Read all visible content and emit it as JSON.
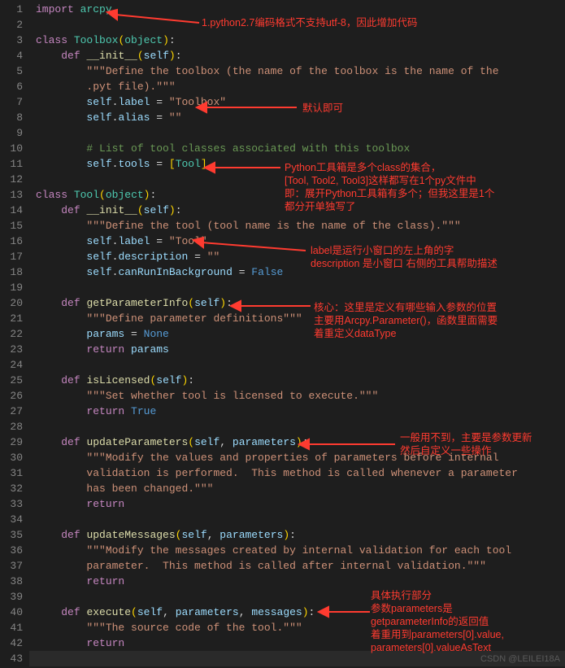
{
  "line_count": 43,
  "code_lines": {
    "l1": {
      "t": [
        [
          "kw",
          "import"
        ],
        [
          "op",
          " "
        ],
        [
          "cls",
          "arcpy"
        ]
      ]
    },
    "l2": {
      "t": []
    },
    "l3": {
      "t": [
        [
          "kw",
          "class"
        ],
        [
          "op",
          " "
        ],
        [
          "cls",
          "Toolbox"
        ],
        [
          "bracket1",
          "("
        ],
        [
          "cls",
          "object"
        ],
        [
          "bracket1",
          ")"
        ],
        [
          "op",
          ":"
        ]
      ]
    },
    "l4": {
      "indent": 1,
      "t": [
        [
          "kw",
          "def"
        ],
        [
          "op",
          " "
        ],
        [
          "fn",
          "__init__"
        ],
        [
          "bracket1",
          "("
        ],
        [
          "selfc",
          "self"
        ],
        [
          "bracket1",
          ")"
        ],
        [
          "op",
          ":"
        ]
      ]
    },
    "l5": {
      "indent": 2,
      "t": [
        [
          "str",
          "\"\"\"Define the toolbox (the name of the toolbox is the name of the"
        ]
      ]
    },
    "l6": {
      "indent": 2,
      "t": [
        [
          "str",
          ".pyt file).\"\"\""
        ]
      ]
    },
    "l7": {
      "indent": 2,
      "t": [
        [
          "selfc",
          "self"
        ],
        [
          "op",
          "."
        ],
        [
          "var",
          "label"
        ],
        [
          "op",
          " = "
        ],
        [
          "str",
          "\"Toolbox\""
        ]
      ]
    },
    "l8": {
      "indent": 2,
      "t": [
        [
          "selfc",
          "self"
        ],
        [
          "op",
          "."
        ],
        [
          "var",
          "alias"
        ],
        [
          "op",
          " = "
        ],
        [
          "str",
          "\"\""
        ]
      ]
    },
    "l9": {
      "t": []
    },
    "l10": {
      "indent": 2,
      "t": [
        [
          "cmt",
          "# List of tool classes associated with this toolbox"
        ]
      ]
    },
    "l11": {
      "indent": 2,
      "t": [
        [
          "selfc",
          "self"
        ],
        [
          "op",
          "."
        ],
        [
          "var",
          "tools"
        ],
        [
          "op",
          " = "
        ],
        [
          "bracket1",
          "["
        ],
        [
          "cls",
          "Tool"
        ],
        [
          "bracket1",
          "]"
        ]
      ]
    },
    "l12": {
      "t": []
    },
    "l13": {
      "t": [
        [
          "kw",
          "class"
        ],
        [
          "op",
          " "
        ],
        [
          "cls",
          "Tool"
        ],
        [
          "bracket1",
          "("
        ],
        [
          "cls",
          "object"
        ],
        [
          "bracket1",
          ")"
        ],
        [
          "op",
          ":"
        ]
      ]
    },
    "l14": {
      "indent": 1,
      "t": [
        [
          "kw",
          "def"
        ],
        [
          "op",
          " "
        ],
        [
          "fn",
          "__init__"
        ],
        [
          "bracket1",
          "("
        ],
        [
          "selfc",
          "self"
        ],
        [
          "bracket1",
          ")"
        ],
        [
          "op",
          ":"
        ]
      ]
    },
    "l15": {
      "indent": 2,
      "t": [
        [
          "str",
          "\"\"\"Define the tool (tool name is the name of the class).\"\"\""
        ]
      ]
    },
    "l16": {
      "indent": 2,
      "t": [
        [
          "selfc",
          "self"
        ],
        [
          "op",
          "."
        ],
        [
          "var",
          "label"
        ],
        [
          "op",
          " = "
        ],
        [
          "str",
          "\"Tool\""
        ]
      ]
    },
    "l17": {
      "indent": 2,
      "t": [
        [
          "selfc",
          "self"
        ],
        [
          "op",
          "."
        ],
        [
          "var",
          "description"
        ],
        [
          "op",
          " = "
        ],
        [
          "str",
          "\"\""
        ]
      ]
    },
    "l18": {
      "indent": 2,
      "t": [
        [
          "selfc",
          "self"
        ],
        [
          "op",
          "."
        ],
        [
          "var",
          "canRunInBackground"
        ],
        [
          "op",
          " = "
        ],
        [
          "const",
          "False"
        ]
      ]
    },
    "l19": {
      "t": []
    },
    "l20": {
      "indent": 1,
      "t": [
        [
          "kw",
          "def"
        ],
        [
          "op",
          " "
        ],
        [
          "fn",
          "getParameterInfo"
        ],
        [
          "bracket1",
          "("
        ],
        [
          "selfc",
          "self"
        ],
        [
          "bracket1",
          ")"
        ],
        [
          "op",
          ":"
        ]
      ]
    },
    "l21": {
      "indent": 2,
      "t": [
        [
          "str",
          "\"\"\"Define parameter definitions\"\"\""
        ]
      ]
    },
    "l22": {
      "indent": 2,
      "t": [
        [
          "var",
          "params"
        ],
        [
          "op",
          " = "
        ],
        [
          "const",
          "None"
        ]
      ]
    },
    "l23": {
      "indent": 2,
      "t": [
        [
          "kw",
          "return"
        ],
        [
          "op",
          " "
        ],
        [
          "var",
          "params"
        ]
      ]
    },
    "l24": {
      "t": []
    },
    "l25": {
      "indent": 1,
      "t": [
        [
          "kw",
          "def"
        ],
        [
          "op",
          " "
        ],
        [
          "fn",
          "isLicensed"
        ],
        [
          "bracket1",
          "("
        ],
        [
          "selfc",
          "self"
        ],
        [
          "bracket1",
          ")"
        ],
        [
          "op",
          ":"
        ]
      ]
    },
    "l26": {
      "indent": 2,
      "t": [
        [
          "str",
          "\"\"\"Set whether tool is licensed to execute.\"\"\""
        ]
      ]
    },
    "l27": {
      "indent": 2,
      "t": [
        [
          "kw",
          "return"
        ],
        [
          "op",
          " "
        ],
        [
          "const",
          "True"
        ]
      ]
    },
    "l28": {
      "t": []
    },
    "l29": {
      "indent": 1,
      "t": [
        [
          "kw",
          "def"
        ],
        [
          "op",
          " "
        ],
        [
          "fn",
          "updateParameters"
        ],
        [
          "bracket1",
          "("
        ],
        [
          "selfc",
          "self"
        ],
        [
          "op",
          ", "
        ],
        [
          "var",
          "parameters"
        ],
        [
          "bracket1",
          ")"
        ],
        [
          "op",
          ":"
        ]
      ]
    },
    "l30": {
      "indent": 2,
      "t": [
        [
          "str",
          "\"\"\"Modify the values and properties of parameters before internal"
        ]
      ]
    },
    "l31": {
      "indent": 2,
      "t": [
        [
          "str",
          "validation is performed.  This method is called whenever a parameter"
        ]
      ]
    },
    "l32": {
      "indent": 2,
      "t": [
        [
          "str",
          "has been changed.\"\"\""
        ]
      ]
    },
    "l33": {
      "indent": 2,
      "t": [
        [
          "kw",
          "return"
        ]
      ]
    },
    "l34": {
      "t": []
    },
    "l35": {
      "indent": 1,
      "t": [
        [
          "kw",
          "def"
        ],
        [
          "op",
          " "
        ],
        [
          "fn",
          "updateMessages"
        ],
        [
          "bracket1",
          "("
        ],
        [
          "selfc",
          "self"
        ],
        [
          "op",
          ", "
        ],
        [
          "var",
          "parameters"
        ],
        [
          "bracket1",
          ")"
        ],
        [
          "op",
          ":"
        ]
      ]
    },
    "l36": {
      "indent": 2,
      "t": [
        [
          "str",
          "\"\"\"Modify the messages created by internal validation for each tool"
        ]
      ]
    },
    "l37": {
      "indent": 2,
      "t": [
        [
          "str",
          "parameter.  This method is called after internal validation.\"\"\""
        ]
      ]
    },
    "l38": {
      "indent": 2,
      "t": [
        [
          "kw",
          "return"
        ]
      ]
    },
    "l39": {
      "t": []
    },
    "l40": {
      "indent": 1,
      "t": [
        [
          "kw",
          "def"
        ],
        [
          "op",
          " "
        ],
        [
          "fn",
          "execute"
        ],
        [
          "bracket1",
          "("
        ],
        [
          "selfc",
          "self"
        ],
        [
          "op",
          ", "
        ],
        [
          "var",
          "parameters"
        ],
        [
          "op",
          ", "
        ],
        [
          "var",
          "messages"
        ],
        [
          "bracket1",
          ")"
        ],
        [
          "op",
          ":"
        ]
      ]
    },
    "l41": {
      "indent": 2,
      "t": [
        [
          "str",
          "\"\"\"The source code of the tool.\"\"\""
        ]
      ]
    },
    "l42": {
      "indent": 2,
      "t": [
        [
          "kw",
          "return"
        ]
      ]
    },
    "l43": {
      "t": [],
      "cursor": true
    }
  },
  "annotations": {
    "a1": "1.python2.7编码格式不支持utf-8，因此增加代码",
    "a2": "默认即可",
    "a3_l1": "Python工具箱是多个class的集合，",
    "a3_l2": "[Tool, Tool2, Tool3]这样都写在1个py文件中",
    "a3_l3": "即：展开Python工具箱有多个；但我这里是1个",
    "a3_l4": "都分开单独写了",
    "a4_l1": "label是运行小窗口的左上角的字",
    "a4_l2": "description 是小窗口 右侧的工具帮助描述",
    "a5_l1": "核心：这里是定义有哪些输入参数的位置",
    "a5_l2": "主要用Arcpy.Parameter()，函数里面需要",
    "a5_l3": "着重定义dataType",
    "a6_l1": "一般用不到，主要是参数更新",
    "a6_l2": "然后自定义一些操作",
    "a7_l1": "具体执行部分",
    "a7_l2": "参数parameters是",
    "a7_l3": "getparameterInfo的返回值",
    "a7_l4": "着重用到parameters[0].value,",
    "a7_l5": "parameters[0].valueAsText"
  },
  "watermark": "CSDN @LEILEI18A"
}
